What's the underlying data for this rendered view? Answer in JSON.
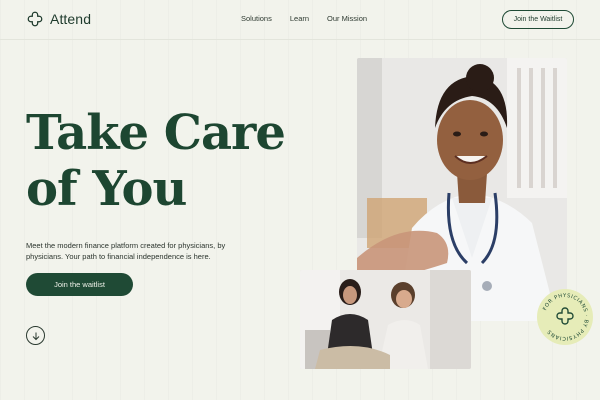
{
  "brand": {
    "name": "Attend",
    "icon": "quatrefoil-logo-icon"
  },
  "nav": {
    "links": [
      "Solutions",
      "Learn",
      "Our Mission"
    ],
    "cta_label": "Join the Waitlist"
  },
  "hero": {
    "headline_line1": "Take Care",
    "headline_line2": "of You",
    "subtext": "Meet the modern finance platform created for physicians, by physicians. Your path to financial independence is here.",
    "cta_label": "Join the waitlist",
    "scroll_icon": "arrow-down-circle-icon"
  },
  "badge": {
    "text": "FOR PHYSICIANS · BY PHYSICIANS",
    "icon": "quatrefoil-icon"
  },
  "colors": {
    "background": "#f2f3ec",
    "primary_green": "#1f4a35",
    "headline_green": "#1d4631",
    "badge_yellow": "#e6ecb8"
  },
  "images": {
    "main_photo": "smiling physician with stethoscope",
    "secondary_photo": "two people looking at a phone"
  }
}
